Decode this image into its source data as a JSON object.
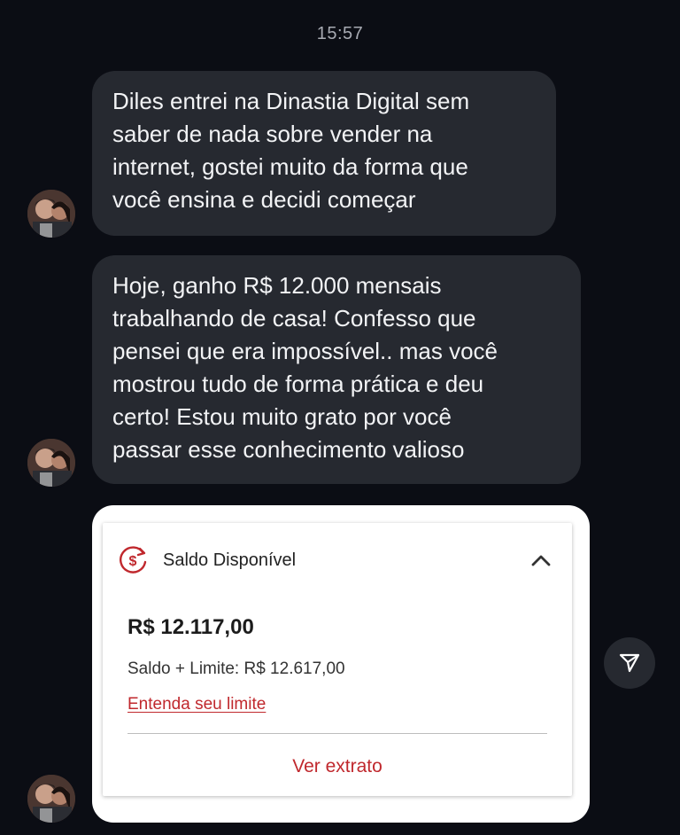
{
  "chat": {
    "timestamp": "15:57",
    "messages": [
      {
        "text": "Diles entrei na Dinastia Digital sem\nsaber de nada sobre vender na\ninternet, gostei muito da forma que\nvocê ensina e decidi começar"
      },
      {
        "text": "Hoje, ganho R$ 12.000 mensais\ntrabalhando de casa! Confesso que\npensei que era impossível.. mas você\nmostrou tudo de forma prática e deu\ncerto! Estou muito grato por você\npassar esse conhecimento valioso"
      }
    ]
  },
  "balance_card": {
    "title": "Saldo Disponível",
    "amount": "R$ 12.117,00",
    "limit_text": "Saldo + Limite: R$ 12.617,00",
    "limit_link": "Entenda seu limite",
    "statement_button": "Ver extrato",
    "icon": "money-refresh-icon",
    "accent_color": "#c0282d"
  },
  "icons": {
    "avatar": "avatar-photo",
    "collapse": "chevron-up-icon",
    "send": "send-icon"
  },
  "colors": {
    "background": "#0b0d14",
    "bubble": "#262930",
    "bubble_text": "#f2f3f5",
    "card": "#ffffff"
  }
}
